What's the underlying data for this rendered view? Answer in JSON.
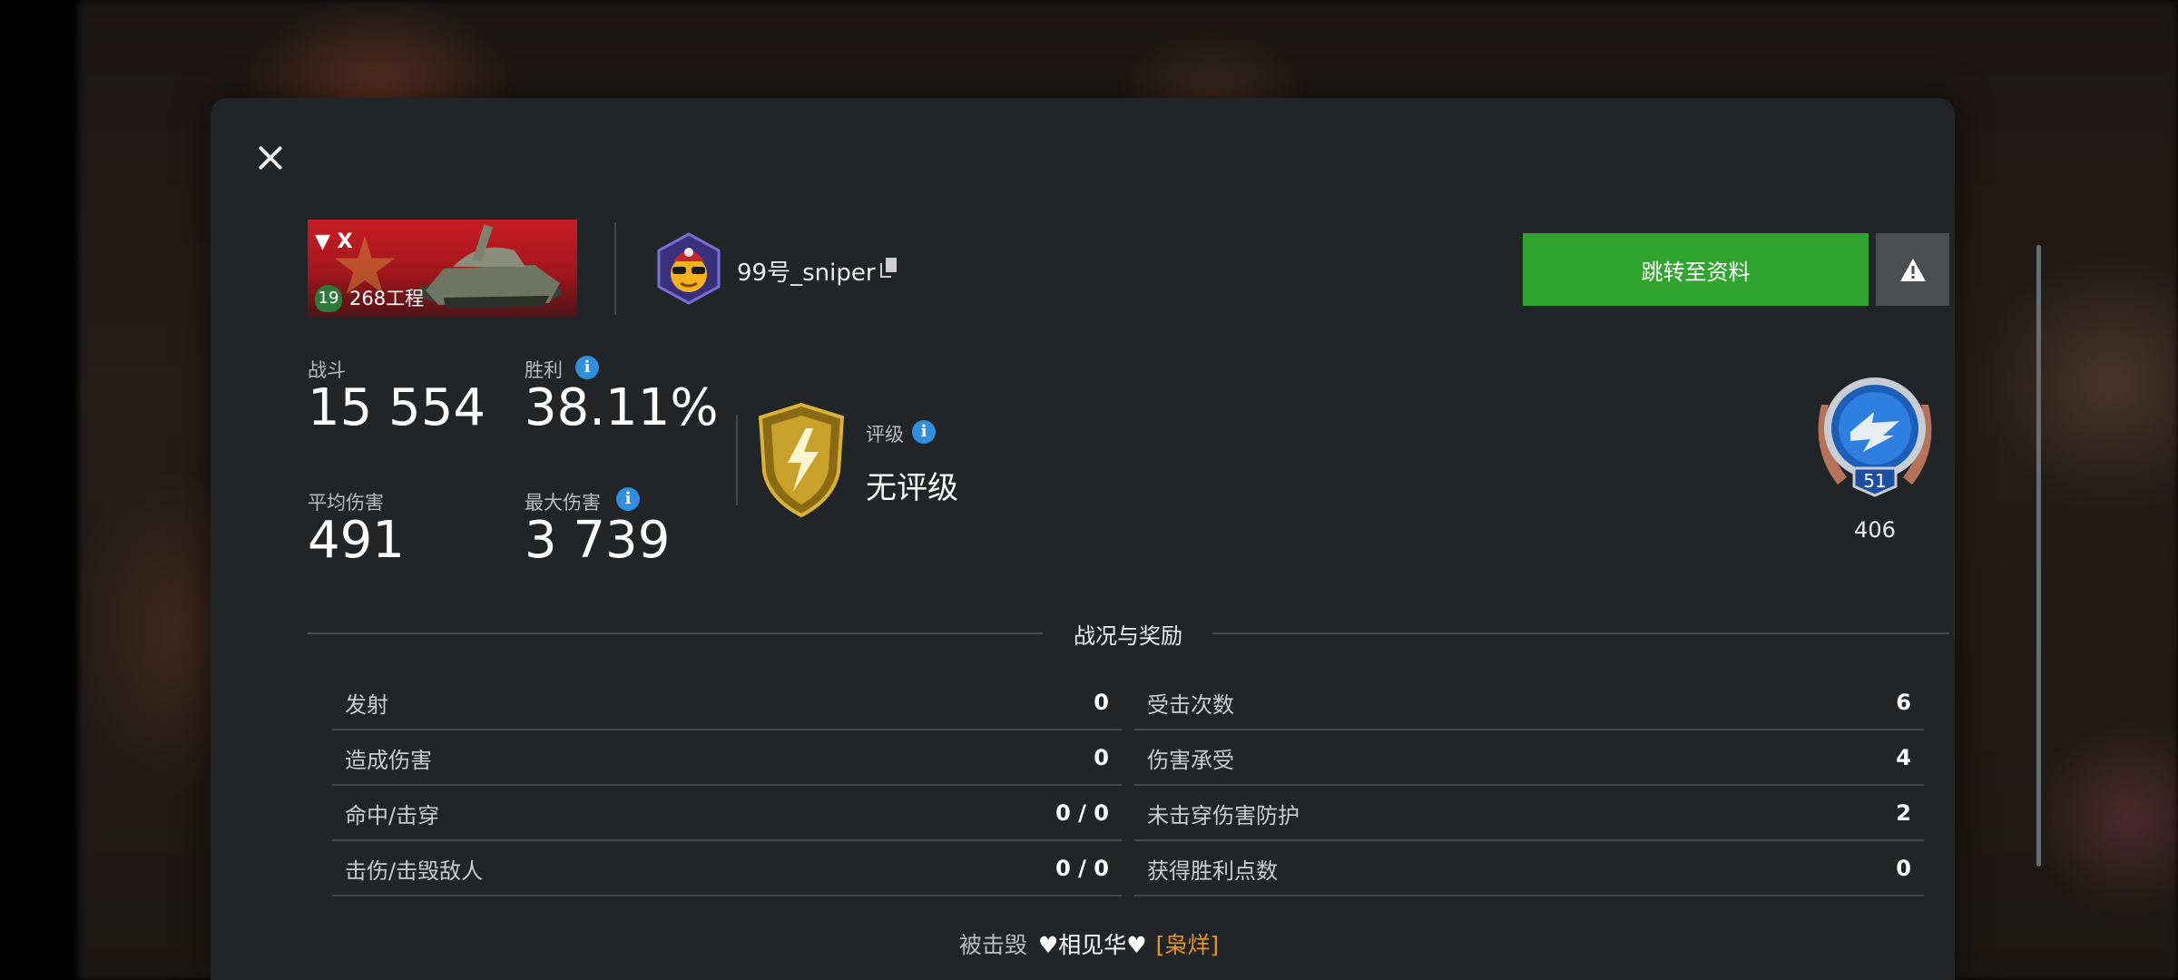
{
  "header": {
    "tank": {
      "tier_roman": "▼ X",
      "level": "19",
      "name": "268工程"
    },
    "player": {
      "name": "99号_sniper"
    },
    "buttons": {
      "profile_label": "跳转至资料"
    }
  },
  "stats": {
    "battles": {
      "label": "战斗",
      "value": "15 554"
    },
    "wins": {
      "label": "胜利",
      "value": "38.11%"
    },
    "avg_damage": {
      "label": "平均伤害",
      "value": "491"
    },
    "max_damage": {
      "label": "最大伤害",
      "value": "3 739"
    },
    "rating": {
      "label": "评级",
      "value": "无评级"
    },
    "mastery": {
      "level": "51",
      "count": "406"
    }
  },
  "section": {
    "title": "战况与奖励",
    "left_rows": [
      {
        "label": "发射",
        "value": "0"
      },
      {
        "label": "造成伤害",
        "value": "0"
      },
      {
        "label": "命中/击穿",
        "value": "0 / 0"
      },
      {
        "label": "击伤/击毁敌人",
        "value": "0 / 0"
      }
    ],
    "right_rows": [
      {
        "label": "受击次数",
        "value": "6"
      },
      {
        "label": "伤害承受",
        "value": "4"
      },
      {
        "label": "未击穿伤害防护",
        "value": "2"
      },
      {
        "label": "获得胜利点数",
        "value": "0"
      }
    ]
  },
  "footer": {
    "prefix": "被击毁",
    "killer_name": "♥相见华♥",
    "killer_clan": "[枭烊]"
  },
  "colors": {
    "dialog_bg": "#222527",
    "profile_button": "#31a32f",
    "info_icon": "#2f8fde",
    "clan_tag": "#e8951e"
  }
}
